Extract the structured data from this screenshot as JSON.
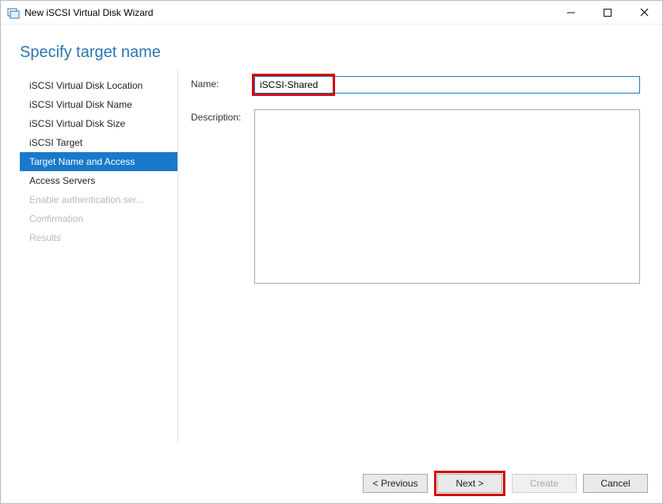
{
  "window": {
    "title": "New iSCSI Virtual Disk Wizard"
  },
  "header": "Specify target name",
  "sidebar": {
    "items": [
      {
        "label": "iSCSI Virtual Disk Location",
        "state": "enabled"
      },
      {
        "label": "iSCSI Virtual Disk Name",
        "state": "enabled"
      },
      {
        "label": "iSCSI Virtual Disk Size",
        "state": "enabled"
      },
      {
        "label": "iSCSI Target",
        "state": "enabled"
      },
      {
        "label": "Target Name and Access",
        "state": "selected"
      },
      {
        "label": "Access Servers",
        "state": "enabled"
      },
      {
        "label": "Enable authentication ser...",
        "state": "disabled"
      },
      {
        "label": "Confirmation",
        "state": "disabled"
      },
      {
        "label": "Results",
        "state": "disabled"
      }
    ]
  },
  "form": {
    "name_label": "Name:",
    "name_value": "iSCSI-Shared",
    "description_label": "Description:",
    "description_value": ""
  },
  "footer": {
    "previous": "< Previous",
    "next": "Next >",
    "create": "Create",
    "cancel": "Cancel"
  }
}
